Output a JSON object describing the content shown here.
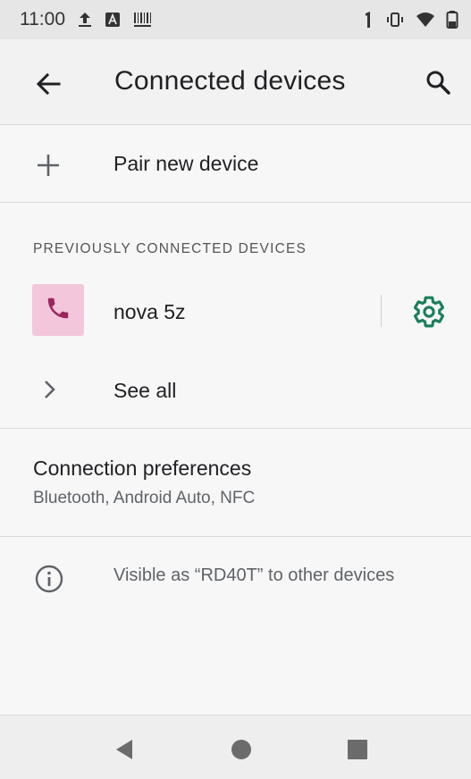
{
  "status_bar": {
    "time": "11:00",
    "icons_left": [
      "upload-icon",
      "notification-a-icon",
      "barcode-icon"
    ],
    "icons_right": [
      "signal-1-icon",
      "vibrate-icon",
      "wifi-icon",
      "battery-icon"
    ]
  },
  "app_bar": {
    "title": "Connected devices",
    "back_icon": "back-arrow-icon",
    "search_icon": "search-icon"
  },
  "pair_new": {
    "label": "Pair new device",
    "icon": "plus-icon"
  },
  "previously_connected": {
    "header": "PREVIOUSLY CONNECTED DEVICES",
    "devices": [
      {
        "name": "nova 5z",
        "icon": "phone-icon",
        "settings_icon": "gear-icon",
        "avatar_color": "#f4c6dc",
        "icon_color": "#9c2560",
        "settings_color": "#1a7f5a"
      }
    ],
    "see_all": "See all"
  },
  "connection_preferences": {
    "title": "Connection preferences",
    "subtitle": "Bluetooth, Android Auto, NFC"
  },
  "info": {
    "text": "Visible as “RD40T” to other devices",
    "icon": "info-icon"
  },
  "nav_bar": {
    "back": "nav-back-icon",
    "home": "nav-home-icon",
    "recents": "nav-recents-icon"
  }
}
